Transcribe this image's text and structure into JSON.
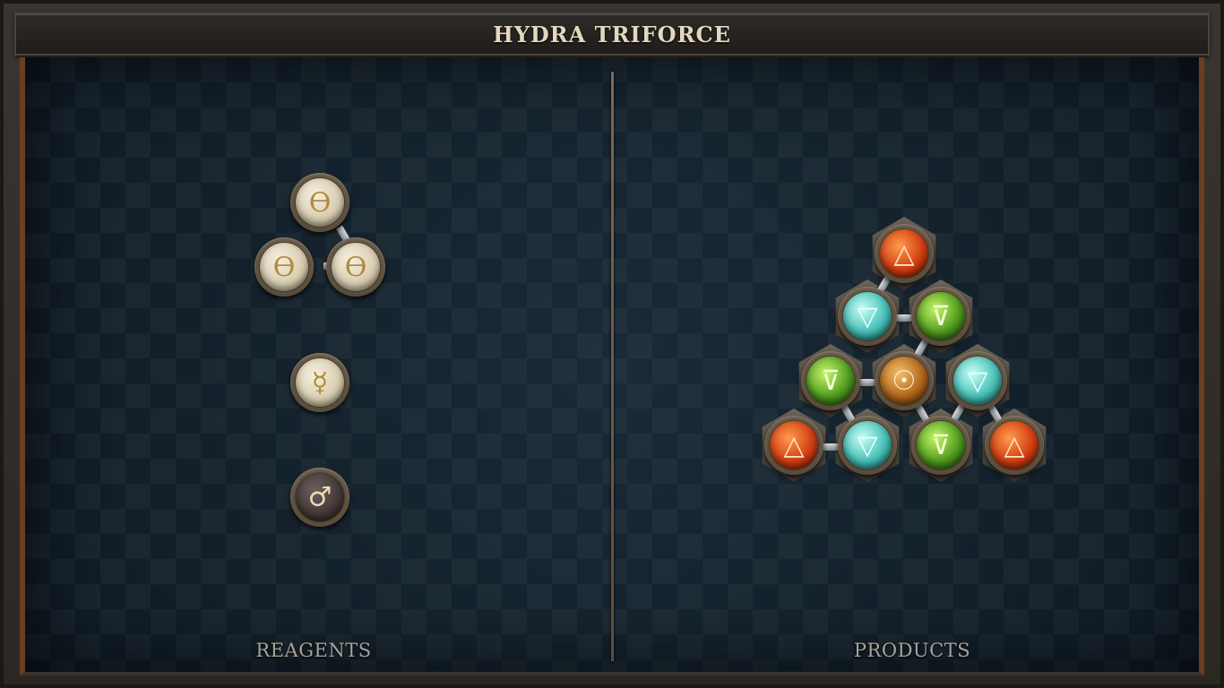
{
  "title": "HYDRA TRIFORCE",
  "panels": {
    "reagents_label": "REAGENTS",
    "products_label": "PRODUCTS"
  },
  "reagents": [
    {
      "name": "theta-triad",
      "color": "cream",
      "glyphs": [
        "ϴ",
        "ϴ",
        "ϴ"
      ]
    },
    {
      "name": "mercury",
      "color": "cream",
      "glyph": "☿"
    },
    {
      "name": "mars",
      "color": "dark",
      "glyph": "♂"
    }
  ],
  "products": {
    "rows": [
      [
        {
          "color": "red",
          "glyph": "△"
        }
      ],
      [
        {
          "color": "cyan",
          "glyph": "▽"
        },
        {
          "color": "green",
          "glyph": "⊽"
        }
      ],
      [
        {
          "color": "green",
          "glyph": "⊽"
        },
        {
          "color": "amber",
          "glyph": "☉"
        },
        {
          "color": "cyan",
          "glyph": "▽"
        }
      ],
      [
        {
          "color": "red",
          "glyph": "△"
        },
        {
          "color": "cyan",
          "glyph": "▽"
        },
        {
          "color": "green",
          "glyph": "⊽"
        },
        {
          "color": "red",
          "glyph": "△"
        }
      ]
    ]
  },
  "colors": {
    "board": "#13202b",
    "frame_accent": "#6b3e22",
    "title_text": "#e3d8bf",
    "label_text": "#a7a49b"
  }
}
